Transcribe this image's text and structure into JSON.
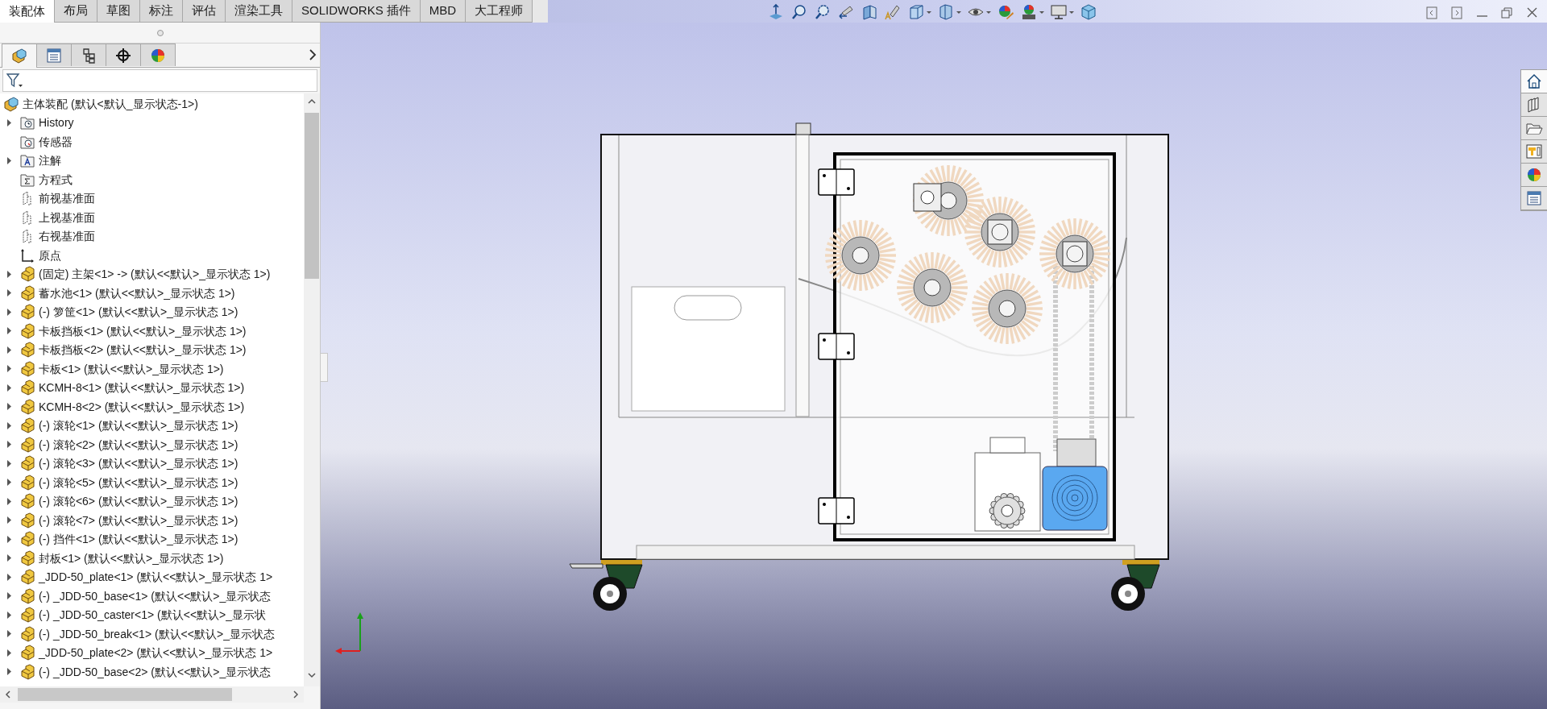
{
  "command_tabs": [
    {
      "label": "装配体",
      "selected": true
    },
    {
      "label": "布局",
      "selected": false
    },
    {
      "label": "草图",
      "selected": false
    },
    {
      "label": "标注",
      "selected": false
    },
    {
      "label": "评估",
      "selected": false
    },
    {
      "label": "渲染工具",
      "selected": false
    },
    {
      "label": "SOLIDWORKS 插件",
      "selected": false
    },
    {
      "label": "MBD",
      "selected": false
    },
    {
      "label": "大工程师",
      "selected": false
    }
  ],
  "panel_tabs": [
    {
      "selected": true
    },
    {
      "selected": false
    },
    {
      "selected": false
    },
    {
      "selected": false
    },
    {
      "selected": false
    }
  ],
  "tree": {
    "label": "主体装配 (默认<默认_显示状态-1>)",
    "kind": "assembly",
    "children": [
      {
        "label": "History",
        "kind": "history",
        "expandable": true
      },
      {
        "label": "传感器",
        "kind": "sensor",
        "expandable": false
      },
      {
        "label": "注解",
        "kind": "annotation",
        "expandable": true
      },
      {
        "label": "方程式",
        "kind": "equation",
        "expandable": false
      },
      {
        "label": "前视基准面",
        "kind": "plane",
        "expandable": false
      },
      {
        "label": "上视基准面",
        "kind": "plane",
        "expandable": false
      },
      {
        "label": "右视基准面",
        "kind": "plane",
        "expandable": false
      },
      {
        "label": "原点",
        "kind": "origin",
        "expandable": false
      },
      {
        "label": "(固定) 主架<1> -> (默认<<默认>_显示状态 1>)",
        "kind": "subassembly",
        "expandable": true
      },
      {
        "label": "蓄水池<1> (默认<<默认>_显示状态 1>)",
        "kind": "subassembly",
        "expandable": true
      },
      {
        "label": "(-) 箩筐<1> (默认<<默认>_显示状态 1>)",
        "kind": "subassembly",
        "expandable": true
      },
      {
        "label": "卡板挡板<1> (默认<<默认>_显示状态 1>)",
        "kind": "subassembly",
        "expandable": true
      },
      {
        "label": "卡板挡板<2> (默认<<默认>_显示状态 1>)",
        "kind": "subassembly",
        "expandable": true
      },
      {
        "label": "卡板<1> (默认<<默认>_显示状态 1>)",
        "kind": "subassembly",
        "expandable": true
      },
      {
        "label": "KCMH-8<1> (默认<<默认>_显示状态 1>)",
        "kind": "subassembly",
        "expandable": true
      },
      {
        "label": "KCMH-8<2> (默认<<默认>_显示状态 1>)",
        "kind": "subassembly",
        "expandable": true
      },
      {
        "label": "(-) 滚轮<1> (默认<<默认>_显示状态 1>)",
        "kind": "subassembly",
        "expandable": true
      },
      {
        "label": "(-) 滚轮<2> (默认<<默认>_显示状态 1>)",
        "kind": "subassembly",
        "expandable": true
      },
      {
        "label": "(-) 滚轮<3> (默认<<默认>_显示状态 1>)",
        "kind": "subassembly",
        "expandable": true
      },
      {
        "label": "(-) 滚轮<5> (默认<<默认>_显示状态 1>)",
        "kind": "subassembly",
        "expandable": true
      },
      {
        "label": "(-) 滚轮<6> (默认<<默认>_显示状态 1>)",
        "kind": "subassembly",
        "expandable": true
      },
      {
        "label": "(-) 滚轮<7> (默认<<默认>_显示状态 1>)",
        "kind": "subassembly",
        "expandable": true
      },
      {
        "label": "(-) 挡件<1> (默认<<默认>_显示状态 1>)",
        "kind": "subassembly",
        "expandable": true
      },
      {
        "label": "封板<1> (默认<<默认>_显示状态 1>)",
        "kind": "subassembly",
        "expandable": true
      },
      {
        "label": "_JDD-50_plate<1> (默认<<默认>_显示状态 1>",
        "kind": "subassembly",
        "expandable": true
      },
      {
        "label": "(-) _JDD-50_base<1> (默认<<默认>_显示状态",
        "kind": "subassembly",
        "expandable": true
      },
      {
        "label": "(-) _JDD-50_caster<1> (默认<<默认>_显示状",
        "kind": "subassembly",
        "expandable": true
      },
      {
        "label": "(-) _JDD-50_break<1> (默认<<默认>_显示状态",
        "kind": "subassembly",
        "expandable": true
      },
      {
        "label": "_JDD-50_plate<2> (默认<<默认>_显示状态 1>",
        "kind": "subassembly",
        "expandable": true
      },
      {
        "label": "(-) _JDD-50_base<2> (默认<<默认>_显示状态",
        "kind": "subassembly",
        "expandable": true
      }
    ]
  }
}
